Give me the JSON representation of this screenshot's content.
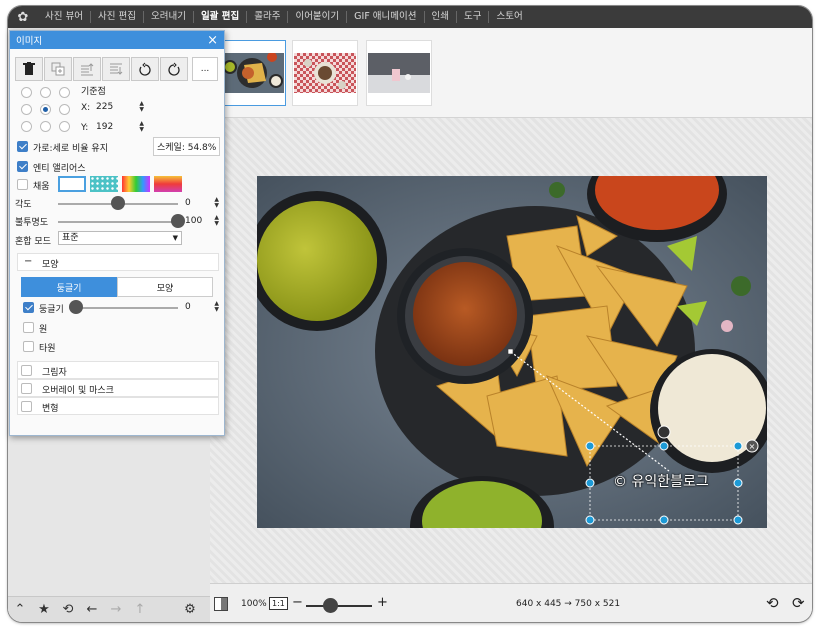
{
  "menu": {
    "items": [
      "사진 뷰어",
      "사진 편집",
      "오려내기",
      "일괄 편집",
      "콜라주",
      "이어붙이기",
      "GIF 애니메이션",
      "인쇄",
      "도구",
      "스토어"
    ],
    "active_index": 3
  },
  "panel": {
    "title": "이미지",
    "toolbar": [
      "trash-icon",
      "duplicate-icon",
      "bring-forward-icon",
      "send-backward-icon",
      "rotate-left-icon",
      "rotate-right-icon"
    ],
    "more_label": "...",
    "anchor_label": "기준점",
    "x_label": "X:",
    "x_value": "225",
    "y_label": "Y:",
    "y_value": "192",
    "keep_ratio_label": "가로:세로 비율 유지",
    "scale_label": "스케일: 54.8%",
    "antialias_label": "엔티 앨리어스",
    "fill_label": "채움",
    "angle_label": "각도",
    "angle_value": "0",
    "opacity_label": "불투명도",
    "opacity_value": "100",
    "blend_label": "혼합 모드",
    "blend_value": "표준",
    "shape_section_label": "모양",
    "tab_round": "둥글기",
    "tab_shape": "모양",
    "round_label": "둥글기",
    "round_value": "0",
    "circle_label": "원",
    "ellipse_label": "타원",
    "shadow_label": "그림자",
    "overlay_label": "오버레이 및 마스크",
    "transform_label": "변형",
    "angle_fraction": 0.5,
    "opacity_fraction": 1.0,
    "round_fraction": 0.0
  },
  "canvas": {
    "watermark_text": "유익한블로그",
    "watermark_prefix": "©"
  },
  "status": {
    "zoom": "100%",
    "one_to_one": "1:1",
    "minus": "−",
    "plus": "+",
    "size_info": "640 x 445 → 750 x 521",
    "zoom_fraction": 0.18
  },
  "colors": {
    "accent": "#3e8fdc",
    "menubar": "#3b3b3b"
  }
}
